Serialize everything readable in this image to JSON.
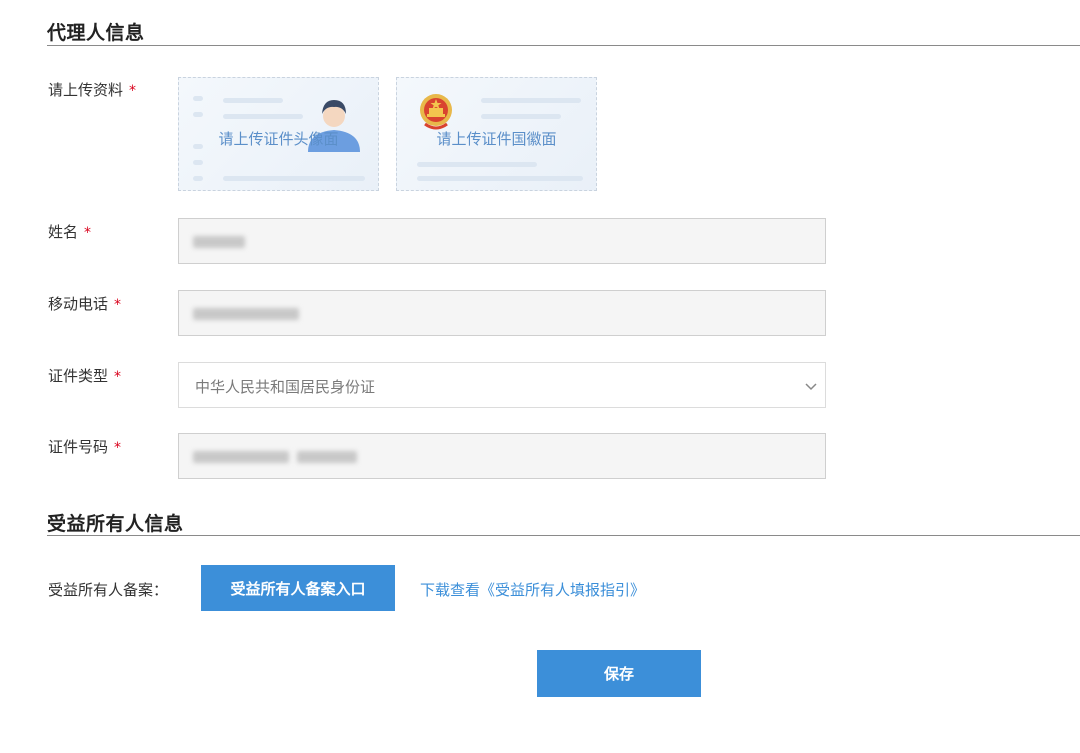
{
  "agent_section": {
    "title": "代理人信息",
    "upload": {
      "label": "请上传资料",
      "required_mark": "*",
      "front_text": "请上传证件头像面",
      "back_text": "请上传证件国徽面"
    },
    "name": {
      "label": "姓名",
      "required_mark": "*"
    },
    "mobile": {
      "label": "移动电话",
      "required_mark": "*"
    },
    "id_type": {
      "label": "证件类型",
      "required_mark": "*",
      "selected": "中华人民共和国居民身份证"
    },
    "id_number": {
      "label": "证件号码",
      "required_mark": "*"
    }
  },
  "beneficiary_section": {
    "title": "受益所有人信息",
    "filing_label": "受益所有人备案：",
    "entry_button": "受益所有人备案入口",
    "guide_link": "下载查看《受益所有人填报指引》"
  },
  "save_button": "保存",
  "colors": {
    "primary": "#3c8fd9",
    "required": "#d9001b",
    "input_bg": "#f5f5f5"
  },
  "icons": [
    "id-portrait-icon",
    "national-emblem-icon",
    "chevron-down-icon"
  ]
}
